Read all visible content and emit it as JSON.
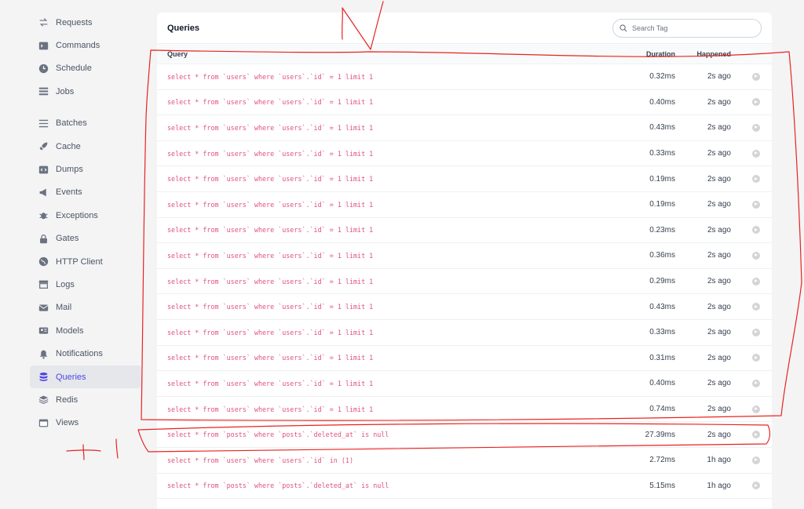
{
  "sidebar": {
    "items": [
      {
        "label": "Requests",
        "icon": "arrows-icon"
      },
      {
        "label": "Commands",
        "icon": "terminal-icon"
      },
      {
        "label": "Schedule",
        "icon": "clock-icon"
      },
      {
        "label": "Jobs",
        "icon": "list-icon"
      },
      {
        "label": "Batches",
        "icon": "menu-icon"
      },
      {
        "label": "Cache",
        "icon": "rocket-icon"
      },
      {
        "label": "Dumps",
        "icon": "code-icon"
      },
      {
        "label": "Events",
        "icon": "megaphone-icon"
      },
      {
        "label": "Exceptions",
        "icon": "bug-icon"
      },
      {
        "label": "Gates",
        "icon": "lock-icon"
      },
      {
        "label": "HTTP Client",
        "icon": "globe-icon"
      },
      {
        "label": "Logs",
        "icon": "archive-icon"
      },
      {
        "label": "Mail",
        "icon": "mail-icon"
      },
      {
        "label": "Models",
        "icon": "id-card-icon"
      },
      {
        "label": "Notifications",
        "icon": "bell-icon"
      },
      {
        "label": "Queries",
        "icon": "database-icon",
        "active": true
      },
      {
        "label": "Redis",
        "icon": "layers-icon"
      },
      {
        "label": "Views",
        "icon": "window-icon"
      }
    ]
  },
  "main": {
    "title": "Queries",
    "search": {
      "placeholder": "Search Tag",
      "value": ""
    },
    "columns": {
      "query": "Query",
      "duration": "Duration",
      "happened": "Happened"
    },
    "rows": [
      {
        "query": "select * from `users` where `users`.`id` = 1 limit 1",
        "duration": "0.32ms",
        "happened": "2s ago"
      },
      {
        "query": "select * from `users` where `users`.`id` = 1 limit 1",
        "duration": "0.40ms",
        "happened": "2s ago"
      },
      {
        "query": "select * from `users` where `users`.`id` = 1 limit 1",
        "duration": "0.43ms",
        "happened": "2s ago"
      },
      {
        "query": "select * from `users` where `users`.`id` = 1 limit 1",
        "duration": "0.33ms",
        "happened": "2s ago"
      },
      {
        "query": "select * from `users` where `users`.`id` = 1 limit 1",
        "duration": "0.19ms",
        "happened": "2s ago"
      },
      {
        "query": "select * from `users` where `users`.`id` = 1 limit 1",
        "duration": "0.19ms",
        "happened": "2s ago"
      },
      {
        "query": "select * from `users` where `users`.`id` = 1 limit 1",
        "duration": "0.23ms",
        "happened": "2s ago"
      },
      {
        "query": "select * from `users` where `users`.`id` = 1 limit 1",
        "duration": "0.36ms",
        "happened": "2s ago"
      },
      {
        "query": "select * from `users` where `users`.`id` = 1 limit 1",
        "duration": "0.29ms",
        "happened": "2s ago"
      },
      {
        "query": "select * from `users` where `users`.`id` = 1 limit 1",
        "duration": "0.43ms",
        "happened": "2s ago"
      },
      {
        "query": "select * from `users` where `users`.`id` = 1 limit 1",
        "duration": "0.33ms",
        "happened": "2s ago"
      },
      {
        "query": "select * from `users` where `users`.`id` = 1 limit 1",
        "duration": "0.31ms",
        "happened": "2s ago"
      },
      {
        "query": "select * from `users` where `users`.`id` = 1 limit 1",
        "duration": "0.40ms",
        "happened": "2s ago"
      },
      {
        "query": "select * from `users` where `users`.`id` = 1 limit 1",
        "duration": "0.74ms",
        "happened": "2s ago"
      },
      {
        "query": "select * from `posts` where `posts`.`deleted_at` is null",
        "duration": "27.39ms",
        "happened": "2s ago"
      },
      {
        "query": "select * from `users` where `users`.`id` in (1)",
        "duration": "2.72ms",
        "happened": "1h ago"
      },
      {
        "query": "select * from `posts` where `posts`.`deleted_at` is null",
        "duration": "5.15ms",
        "happened": "1h ago"
      }
    ]
  },
  "annotations": {
    "note": "+1",
    "color": "#e8231f"
  },
  "colors": {
    "accent": "#4f46e5",
    "query_text": "#e0527e",
    "background": "#f4f4f5"
  }
}
